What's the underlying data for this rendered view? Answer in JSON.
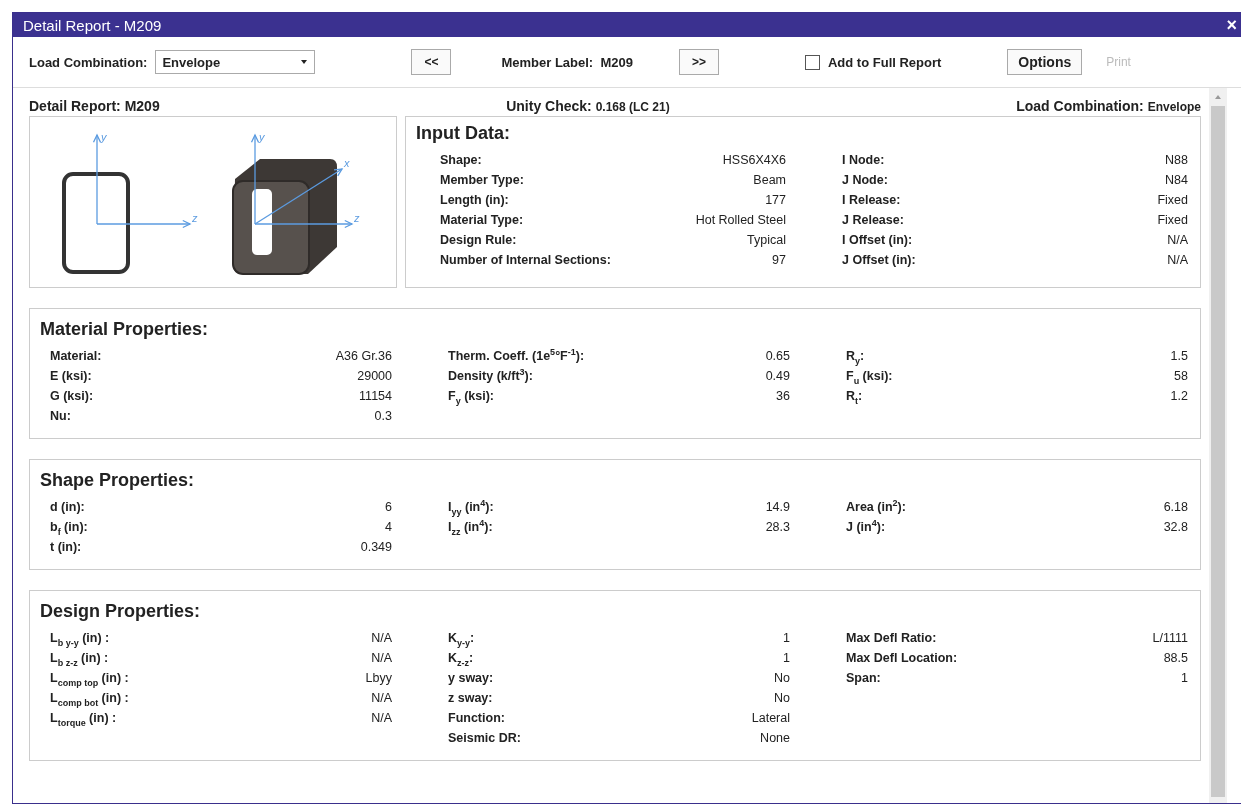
{
  "window": {
    "title": "Detail Report - M209",
    "close": "×"
  },
  "toolbar": {
    "load_combination": {
      "label": "Load Combination:",
      "value": "Envelope"
    },
    "prev": "<<",
    "member_label": {
      "label": "Member Label:",
      "value": "M209"
    },
    "next": ">>",
    "add_to_full_report": {
      "label": "Add to Full Report",
      "checked": false
    },
    "options": "Options",
    "print": {
      "label": "Print",
      "disabled": true
    }
  },
  "header": {
    "report": "Detail Report: M209",
    "unity_check": {
      "label": "Unity Check:",
      "value": "0.168 (LC 21)"
    },
    "load_combination": {
      "label": "Load Combination:",
      "value": "Envelope"
    }
  },
  "drawings": [
    {
      "kind": "outline",
      "axis_labels": [
        "y",
        "z"
      ]
    },
    {
      "kind": "solid",
      "axis_labels": [
        "y",
        "x",
        "z"
      ]
    }
  ],
  "input_data": {
    "title": "Input Data:",
    "columns": [
      [
        {
          "label": "Shape:",
          "value": "HSS6X4X6"
        },
        {
          "label": "Member Type:",
          "value": "Beam"
        },
        {
          "label": "Length (in):",
          "value": "177"
        },
        {
          "label": "Material Type:",
          "value": "Hot Rolled Steel"
        },
        {
          "label": "Design Rule:",
          "value": "Typical"
        },
        {
          "label": "Number of Internal Sections:",
          "value": "97"
        }
      ],
      [
        {
          "label": "I Node:",
          "value": "N88"
        },
        {
          "label": "J Node:",
          "value": "N84"
        },
        {
          "label": "I Release:",
          "value": "Fixed"
        },
        {
          "label": "J Release:",
          "value": "Fixed"
        },
        {
          "label": "I Offset (in):",
          "value": "N/A"
        },
        {
          "label": "J Offset (in):",
          "value": "N/A"
        }
      ]
    ]
  },
  "sections": [
    {
      "title": "Material Properties:",
      "columns": [
        [
          {
            "label": "Material:",
            "value": "A36 Gr.36"
          },
          {
            "label": "E (ksi):",
            "value": "29000"
          },
          {
            "label": "G (ksi):",
            "value": "11154"
          },
          {
            "label": "Nu:",
            "value": "0.3"
          }
        ],
        [
          {
            "label": "Therm. Coeff. (1e$^{5}$°F$^{-1}$):",
            "value": "0.65"
          },
          {
            "label": "Density (k/ft$^{3}$):",
            "value": "0.49"
          },
          {
            "label": "F$_{y}$ (ksi):",
            "value": "36"
          }
        ],
        [
          {
            "label": "R$_{y}$:",
            "value": "1.5"
          },
          {
            "label": "F$_{u}$ (ksi):",
            "value": "58"
          },
          {
            "label": "R$_{t}$:",
            "value": "1.2"
          }
        ]
      ]
    },
    {
      "title": "Shape Properties:",
      "columns": [
        [
          {
            "label": "d (in):",
            "value": "6"
          },
          {
            "label": "b$_{f}$ (in):",
            "value": "4"
          },
          {
            "label": "t (in):",
            "value": "0.349"
          }
        ],
        [
          {
            "label": "I$_{yy}$ (in$^{4}$):",
            "value": "14.9"
          },
          {
            "label": "I$_{zz}$ (in$^{4}$):",
            "value": "28.3"
          }
        ],
        [
          {
            "label": "Area (in$^{2}$):",
            "value": "6.18"
          },
          {
            "label": "J (in$^{4}$):",
            "value": "32.8"
          }
        ]
      ]
    },
    {
      "title": "Design Properties:",
      "columns": [
        [
          {
            "label": "L$_{b y-y}$ (in) :",
            "value": "N/A"
          },
          {
            "label": "L$_{b z-z}$ (in) :",
            "value": "N/A"
          },
          {
            "label": "L$_{comp top}$ (in) :",
            "value": "Lbyy"
          },
          {
            "label": "L$_{comp bot}$ (in) :",
            "value": "N/A"
          },
          {
            "label": "L$_{torque}$ (in) :",
            "value": "N/A"
          }
        ],
        [
          {
            "label": "K$_{y-y}$:",
            "value": "1"
          },
          {
            "label": "K$_{z-z}$:",
            "value": "1"
          },
          {
            "label": "y sway:",
            "value": "No"
          },
          {
            "label": "z sway:",
            "value": "No"
          },
          {
            "label": "Function:",
            "value": "Lateral"
          },
          {
            "label": "Seismic DR:",
            "value": "None"
          }
        ],
        [
          {
            "label": "Max Defl Ratio:",
            "value": "L/1111"
          },
          {
            "label": "Max Defl Location:",
            "value": "88.5"
          },
          {
            "label": "Span:",
            "value": "1"
          }
        ]
      ]
    }
  ]
}
